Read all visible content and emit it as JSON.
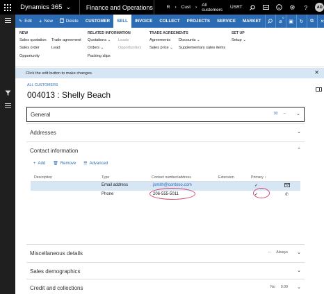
{
  "app": {
    "brand": "Dynamics 365",
    "module": "Finance and Operations",
    "crumb_r": "R",
    "crumb_cust": "Cust",
    "crumb_all": "All customers",
    "company": "USRT",
    "user_initials": "AD",
    "notification_count": "0"
  },
  "actionbar": {
    "edit": "Edit",
    "new": "New",
    "delete": "Delete",
    "tabs": [
      "CUSTOMER",
      "SELL",
      "INVOICE",
      "COLLECT",
      "PROJECTS",
      "SERVICE",
      "MARKET"
    ]
  },
  "ribbon": {
    "new_header": "NEW",
    "new_col1": [
      "Sales quotation",
      "Sales order",
      "Opportunity"
    ],
    "new_col2": [
      "Trade agreement",
      "Lead"
    ],
    "related_header": "RELATED INFORMATION",
    "related_col1": [
      "Quotations",
      "Orders",
      "Packing slips"
    ],
    "related_col2": [
      "Leads",
      "Opportunities"
    ],
    "trade_header": "TRADE AGREEMENTS",
    "trade_col1": [
      "Agreements",
      "Sales price"
    ],
    "trade_col2": [
      "Discounts",
      "Supplementary sales items"
    ],
    "setup_header": "SET UP",
    "setup_col1": [
      "Setup"
    ]
  },
  "message": "Click the edit button to make changes.",
  "page": {
    "breadcrumb": "ALL CUSTOMERS",
    "title": "004013 : Shelly Beach"
  },
  "fasttabs": {
    "general": "General",
    "general_summary": "30",
    "general_summary2": "--",
    "addresses": "Addresses",
    "contact": "Contact information",
    "misc": "Miscellaneous details",
    "misc_summary1": "--",
    "misc_summary2": "Always",
    "sales_demo": "Sales demographics",
    "credit": "Credit and collections",
    "credit_summary1": "No",
    "credit_summary2": "0.00"
  },
  "contact_tools": {
    "add": "Add",
    "remove": "Remove",
    "advanced": "Advanced"
  },
  "contact_grid": {
    "headers": {
      "description": "Description",
      "type": "Type",
      "contact": "Contact number/address",
      "extension": "Extension",
      "primary": "Primary"
    },
    "rows": [
      {
        "type": "Email address",
        "contact": "jsmith@contoso.com",
        "primary": "✓"
      },
      {
        "type": "Phone",
        "contact": "206-555-5011",
        "primary": "✓"
      }
    ]
  }
}
